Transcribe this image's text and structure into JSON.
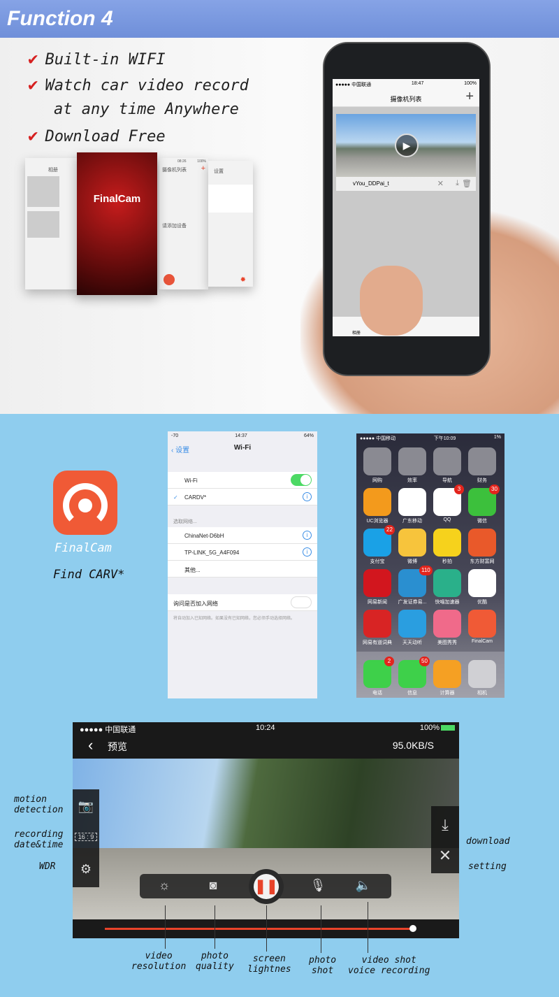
{
  "header": {
    "title": "Function 4"
  },
  "features": [
    "Built-in WIFI",
    "Watch car video record",
    "at any time Anywhere",
    "Download Free"
  ],
  "mini_screens": {
    "album_title": "相册",
    "splash_logo": "FinalCam",
    "camlist_title": "摄像机列表",
    "add_device": "请添加设备",
    "settings_title": "设置",
    "time": "08:26",
    "battery": "100%"
  },
  "phone": {
    "carrier": "●●●●● 中国联通",
    "time": "18:47",
    "battery": "100%",
    "title": "摄像机列表",
    "add": "+",
    "device_name": "vYou_DDPai_t",
    "tab_album": "相册"
  },
  "wifi_screen": {
    "signal": "-70",
    "time": "14:37",
    "battery": "64%",
    "back": "设置",
    "title": "Wi-Fi",
    "wifi_label": "Wi-Fi",
    "wifi_on": true,
    "connected": "CARDV*",
    "choose": "选取网络...",
    "networks": [
      "ChinaNet-D6bH",
      "TP-LINK_5G_A4F094",
      "其他..."
    ],
    "ask_label": "询问是否加入网络",
    "ask_on": false,
    "ask_note": "将自动加入已知网络。如果没有已知网络，您必须手动选择网络。"
  },
  "app_icon": {
    "name": "FinalCam",
    "hint": "Find CARV*",
    "color": "#f05a36"
  },
  "home_screen": {
    "carrier": "●●●●● 中国移动",
    "time": "下午10:09",
    "battery": "1%",
    "apps": [
      {
        "label": "网购",
        "color": "#8a8a92",
        "badge": ""
      },
      {
        "label": "效率",
        "color": "#8a8a92",
        "badge": ""
      },
      {
        "label": "导航",
        "color": "#8a8a92",
        "badge": ""
      },
      {
        "label": "财务",
        "color": "#8a8a92",
        "badge": ""
      },
      {
        "label": "UC浏览器",
        "color": "#f39a1c",
        "badge": ""
      },
      {
        "label": "广东移动",
        "color": "#ffffff",
        "badge": ""
      },
      {
        "label": "QQ",
        "color": "#ffffff",
        "badge": "3"
      },
      {
        "label": "微信",
        "color": "#3cc03c",
        "badge": "30"
      },
      {
        "label": "支付宝",
        "color": "#1aa1e6",
        "badge": "22"
      },
      {
        "label": "微博",
        "color": "#f7c43c",
        "badge": ""
      },
      {
        "label": "秒拍",
        "color": "#f6d21c",
        "badge": ""
      },
      {
        "label": "东方财富网",
        "color": "#e9592a",
        "badge": ""
      },
      {
        "label": "网易新闻",
        "color": "#d2161e",
        "badge": ""
      },
      {
        "label": "广发证券易...",
        "color": "#2a8fd0",
        "badge": "110"
      },
      {
        "label": "快喵加速器",
        "color": "#2ab08a",
        "badge": ""
      },
      {
        "label": "优酷",
        "color": "#ffffff",
        "badge": ""
      },
      {
        "label": "网易有道词典",
        "color": "#d82424",
        "badge": ""
      },
      {
        "label": "天天动听",
        "color": "#2a9ee0",
        "badge": ""
      },
      {
        "label": "美图秀秀",
        "color": "#f06a8a",
        "badge": ""
      },
      {
        "label": "FinalCam",
        "color": "#f05a36",
        "badge": ""
      }
    ],
    "dock": [
      {
        "label": "电话",
        "color": "#3ed04a",
        "badge": "2"
      },
      {
        "label": "信息",
        "color": "#3ed04a",
        "badge": "50"
      },
      {
        "label": "计算器",
        "color": "#f5a023",
        "badge": ""
      },
      {
        "label": "相机",
        "color": "#d0d0d4",
        "badge": ""
      }
    ]
  },
  "live_view": {
    "carrier": "●●●●● 中国联通",
    "time": "10:24",
    "battery": "100%",
    "title": "预览",
    "speed": "95.0KB/S",
    "progress": 0.98,
    "aspect": "16 : 9"
  },
  "annotations": {
    "left": [
      "motion\ndetection",
      "recording\ndate&time",
      "WDR"
    ],
    "right": [
      "download",
      "setting"
    ],
    "bottom": [
      "video\nresolution",
      "photo\nquality",
      "screen\nlightnes",
      "photo\nshot",
      "video shot\nvoice recording"
    ]
  },
  "colors": {
    "header": "#7794dc",
    "bottom_bg": "#8fcdee",
    "accent": "#e8432a"
  }
}
